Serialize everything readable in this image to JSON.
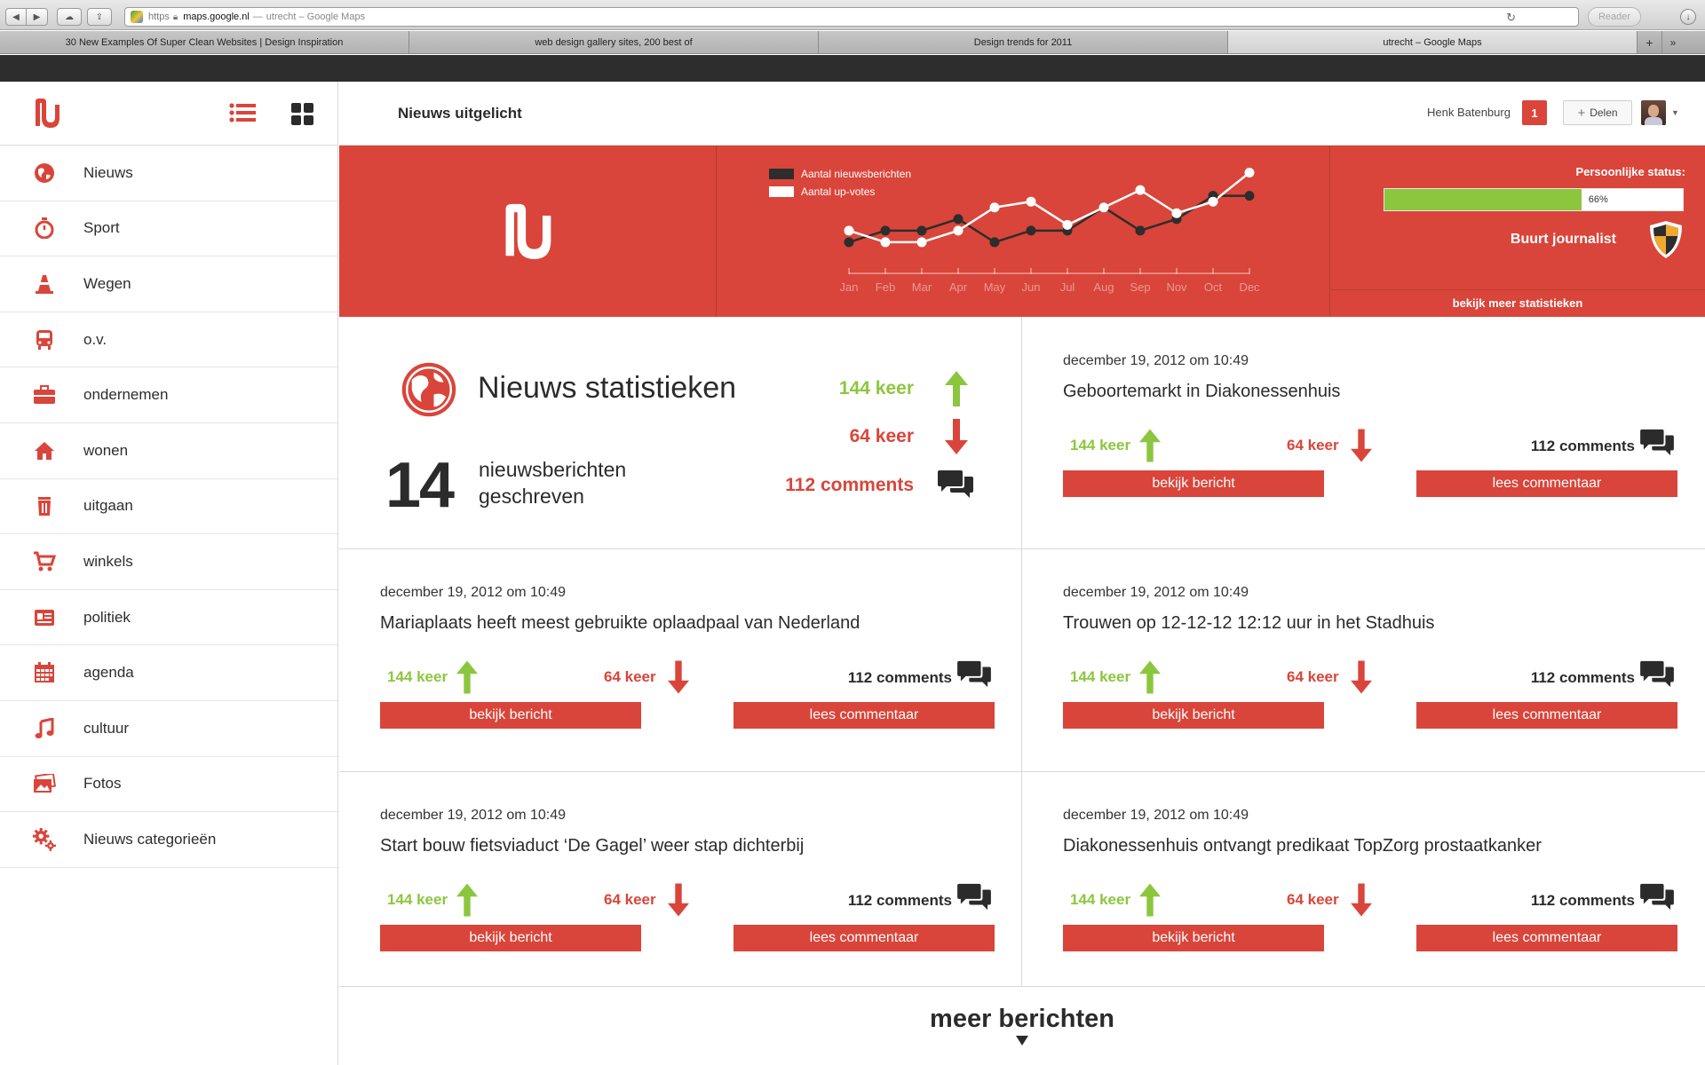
{
  "browser": {
    "url_scheme": "https",
    "url_host": "maps.google.nl",
    "url_page_title": "utrecht – Google Maps",
    "reader_label": "Reader",
    "tabs": [
      {
        "label": "30 New Examples Of Super Clean Websites | Design Inspiration",
        "active": false
      },
      {
        "label": "web design gallery sites, 200 best of",
        "active": false
      },
      {
        "label": "Design trends for 2011",
        "active": false
      },
      {
        "label": "utrecht – Google Maps",
        "active": true
      }
    ]
  },
  "colors": {
    "accent": "#d9453a",
    "positive": "#8cc63e",
    "text": "#2b2b2b",
    "dark_bar": "#2d2d2d"
  },
  "sidebar": {
    "items": [
      {
        "label": "Nieuws",
        "icon": "globe-icon"
      },
      {
        "label": "Sport",
        "icon": "stopwatch-icon"
      },
      {
        "label": "Wegen",
        "icon": "traffic-cone-icon"
      },
      {
        "label": "o.v.",
        "icon": "bus-icon"
      },
      {
        "label": "ondernemen",
        "icon": "briefcase-icon"
      },
      {
        "label": "wonen",
        "icon": "home-icon"
      },
      {
        "label": "uitgaan",
        "icon": "drink-icon"
      },
      {
        "label": "winkels",
        "icon": "cart-icon"
      },
      {
        "label": "politiek",
        "icon": "id-card-icon"
      },
      {
        "label": "agenda",
        "icon": "calendar-icon"
      },
      {
        "label": "cultuur",
        "icon": "music-note-icon"
      },
      {
        "label": "Fotos",
        "icon": "photos-icon"
      },
      {
        "label": "Nieuws categorieën",
        "icon": "gears-icon"
      }
    ]
  },
  "header": {
    "title": "Nieuws uitgelicht",
    "user_name": "Henk Batenburg",
    "notification_count": "1",
    "share_label": "Delen"
  },
  "banner": {
    "legend": [
      {
        "label": "Aantal nieuwsberichten",
        "color": "#2d2d2d"
      },
      {
        "label": "Aantal up-votes",
        "color": "#ffffff"
      }
    ],
    "status_title": "Persoonlijke status:",
    "progress": 66,
    "progress_label": "66%",
    "rank": "Buurt journalist",
    "more_stats": "bekijk meer statistieken"
  },
  "chart_data": {
    "type": "line",
    "categories": [
      "Jan",
      "Feb",
      "Mar",
      "Apr",
      "May",
      "Jun",
      "Jul",
      "Aug",
      "Sep",
      "Nov",
      "Oct",
      "Dec"
    ],
    "series": [
      {
        "name": "Aantal nieuwsberichten",
        "color": "#2d2d2d",
        "values": [
          2,
          4,
          4,
          6,
          2,
          4,
          4,
          8,
          4,
          6,
          10,
          10
        ]
      },
      {
        "name": "Aantal up-votes",
        "color": "#ffffff",
        "values": [
          4,
          2,
          2,
          4,
          8,
          9,
          5,
          8,
          11,
          7,
          9,
          14
        ]
      }
    ],
    "ylim": [
      0,
      15
    ],
    "grid": false
  },
  "stats": {
    "title": "Nieuws statistieken",
    "count": "14",
    "count_label_line1": "nieuwsberichten",
    "count_label_line2": "geschreven",
    "up": "144 keer",
    "down": "64 keer",
    "comments": "112 comments"
  },
  "news": [
    {
      "date": "december 19, 2012 om 10:49",
      "title": "Geboortemarkt in Diakonessenhuis",
      "up": "144 keer",
      "down": "64 keer",
      "comments": "112 comments",
      "view_label": "bekijk bericht",
      "comment_label": "lees commentaar"
    },
    {
      "date": "december 19, 2012 om 10:49",
      "title": "Mariaplaats heeft meest gebruikte oplaadpaal van Nederland",
      "up": "144 keer",
      "down": "64 keer",
      "comments": "112 comments",
      "view_label": "bekijk bericht",
      "comment_label": "lees commentaar"
    },
    {
      "date": "december 19, 2012 om 10:49",
      "title": "Trouwen op 12-12-12 12:12 uur in het Stadhuis",
      "up": "144 keer",
      "down": "64 keer",
      "comments": "112 comments",
      "view_label": "bekijk bericht",
      "comment_label": "lees commentaar"
    },
    {
      "date": "december 19, 2012 om 10:49",
      "title": "Start bouw fietsviaduct ‘De Gagel’ weer stap dichterbij",
      "up": "144 keer",
      "down": "64 keer",
      "comments": "112 comments",
      "view_label": "bekijk bericht",
      "comment_label": "lees commentaar"
    },
    {
      "date": "december 19, 2012 om 10:49",
      "title": "Diakonessenhuis ontvangt predikaat TopZorg prostaatkanker",
      "up": "144 keer",
      "down": "64 keer",
      "comments": "112 comments",
      "view_label": "bekijk bericht",
      "comment_label": "lees commentaar"
    }
  ],
  "more_label": "meer berichten"
}
